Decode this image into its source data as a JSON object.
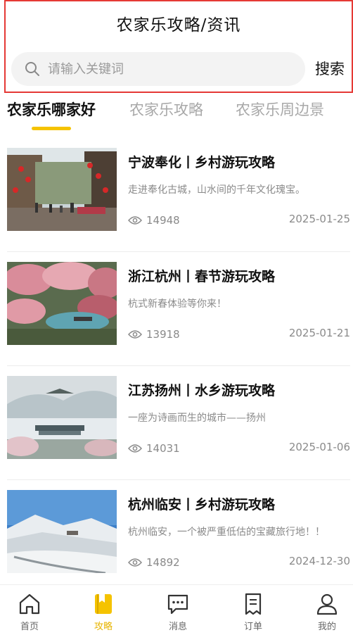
{
  "header": {
    "title": "农家乐攻略/资讯",
    "search_placeholder": "请输入关键词",
    "search_button": "搜索"
  },
  "tabs": [
    {
      "label": "农家乐哪家好",
      "active": true
    },
    {
      "label": "农家乐攻略",
      "active": false
    },
    {
      "label": "农家乐周边景",
      "active": false
    }
  ],
  "articles": [
    {
      "title": "宁波奉化丨乡村游玩攻略",
      "desc": "走进奉化古城，山水间的千年文化瑰宝。",
      "views": "14948",
      "date": "2025-01-25",
      "image": "old-town-street-with-red-lanterns"
    },
    {
      "title": "浙江杭州丨春节游玩攻略",
      "desc": "杭式新春体验等你来！",
      "views": "13918",
      "date": "2025-01-21",
      "image": "plum-blossom-garden-with-pond"
    },
    {
      "title": "江苏扬州丨水乡游玩攻略",
      "desc": "一座为诗画而生的城市——扬州",
      "views": "14031",
      "date": "2025-01-06",
      "image": "misty-lake-pavilion"
    },
    {
      "title": "杭州临安丨乡村游玩攻略",
      "desc": "杭州临安，一个被严重低估的宝藏旅行地！！",
      "views": "14892",
      "date": "2024-12-30",
      "image": "snowy-mountain-village"
    }
  ],
  "tabbar": [
    {
      "label": "首页",
      "icon": "home-icon",
      "active": false
    },
    {
      "label": "攻略",
      "icon": "guide-book-icon",
      "active": true
    },
    {
      "label": "消息",
      "icon": "message-icon",
      "active": false
    },
    {
      "label": "订单",
      "icon": "order-icon",
      "active": false
    },
    {
      "label": "我的",
      "icon": "user-icon",
      "active": false
    }
  ],
  "colors": {
    "accent": "#f5c300",
    "active_label": "#e7b400",
    "highlight_border": "#e53935"
  }
}
